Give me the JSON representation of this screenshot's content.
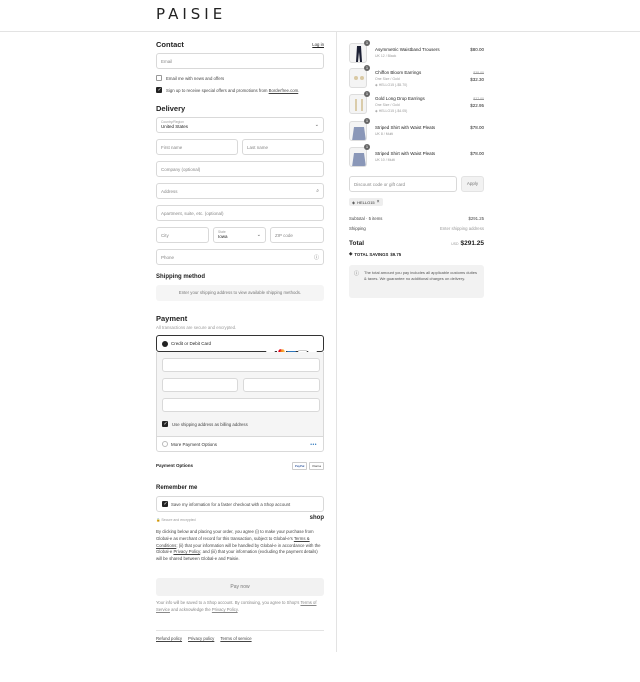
{
  "brand": "PAISIE",
  "contact": {
    "title": "Contact",
    "login": "Log in",
    "email_placeholder": "Email",
    "news_label": "Email me with news and offers",
    "special_label_prefix": "Sign up to receive special offers and promotions from ",
    "special_label_link": "Borderfree.com",
    "special_label_suffix": "."
  },
  "delivery": {
    "title": "Delivery",
    "country_label": "Country/Region",
    "country_value": "United States",
    "first_name": "First name",
    "last_name": "Last name",
    "company": "Company (optional)",
    "address": "Address",
    "apartment": "Apartment, suite, etc. (optional)",
    "city": "City",
    "state_label": "State",
    "state_value": "Iowa",
    "zip": "ZIP code",
    "phone": "Phone"
  },
  "shipping": {
    "title": "Shipping method",
    "message": "Enter your shipping address to view available shipping methods."
  },
  "payment": {
    "title": "Payment",
    "subtitle": "All transactions are secure and encrypted.",
    "card_option": "Credit or Debit Card",
    "card_logos": [
      "VISA",
      "MC",
      "AMEX",
      "DC",
      "+1"
    ],
    "billing_label": "Use shipping address as billing address",
    "more_options": "More Payment Options",
    "options_title": "Payment Options",
    "option_badges": [
      "PayPal",
      "Klarna"
    ]
  },
  "remember": {
    "title": "Remember me",
    "save_label": "Save my information for a faster checkout with a Shop account",
    "secure_note": "Secure and encrypted",
    "shop_logo": "shop"
  },
  "legal": {
    "text_1": "By clicking below and placing your order, you agree (i) to make your purchase from Global-e as merchant of record for this transaction, subject to Global-e's ",
    "terms_link": "Terms & Conditions",
    "text_2": "; (ii) that your information will be handled by Global-e in accordance with the Global-e ",
    "privacy_link": "Privacy Policy",
    "text_3": "; and (iii) that your information (excluding the payment details) will be shared between Global-e and Paisie."
  },
  "pay_button": "Pay now",
  "shop_note": {
    "text_1": "Your info will be saved to a Shop account. By continuing, you agree to Shop's ",
    "tos_link": "Terms of Service",
    "text_2": " and acknowledge the ",
    "privacy_link": "Privacy Policy",
    "text_3": "."
  },
  "footer_links": [
    "Refund policy",
    "Privacy policy",
    "Terms of service"
  ],
  "cart": {
    "items": [
      {
        "qty": "1",
        "name": "Asymmetric Waistband Trousers",
        "variant": "UK 12 / Black",
        "price": "$80.00",
        "old_price": "",
        "discount": ""
      },
      {
        "qty": "1",
        "name": "Chiffon Bloom Earrings",
        "variant": "One Size / Gold",
        "price": "$32.30",
        "old_price": "$38.00",
        "discount": "HELLO15 (-$5.70)"
      },
      {
        "qty": "1",
        "name": "Gold Long Drop Earrings",
        "variant": "One Size / Gold",
        "price": "$22.95",
        "old_price": "$27.00",
        "discount": "HELLO15 (-$4.05)"
      },
      {
        "qty": "1",
        "name": "Striped Shirt with Waist Pleats",
        "variant": "UK 8 / Multi",
        "price": "$78.00",
        "old_price": "",
        "discount": ""
      },
      {
        "qty": "1",
        "name": "Striped Shirt with Waist Pleats",
        "variant": "UK 10 / Multi",
        "price": "$78.00",
        "old_price": "",
        "discount": ""
      }
    ],
    "discount_placeholder": "Discount code or gift card",
    "apply": "Apply",
    "code_tag": "HELLO15",
    "subtotal_label": "Subtotal · 5 items",
    "subtotal_value": "$291.25",
    "shipping_label": "Shipping",
    "shipping_value": "Enter shipping address",
    "total_label": "Total",
    "total_currency": "USD",
    "total_value": "$291.25",
    "savings_label": "TOTAL SAVINGS",
    "savings_value": "$9.75",
    "duties_note": "The total amount you pay includes all applicable customs duties & taxes. We guarantee no additional charges on delivery."
  }
}
